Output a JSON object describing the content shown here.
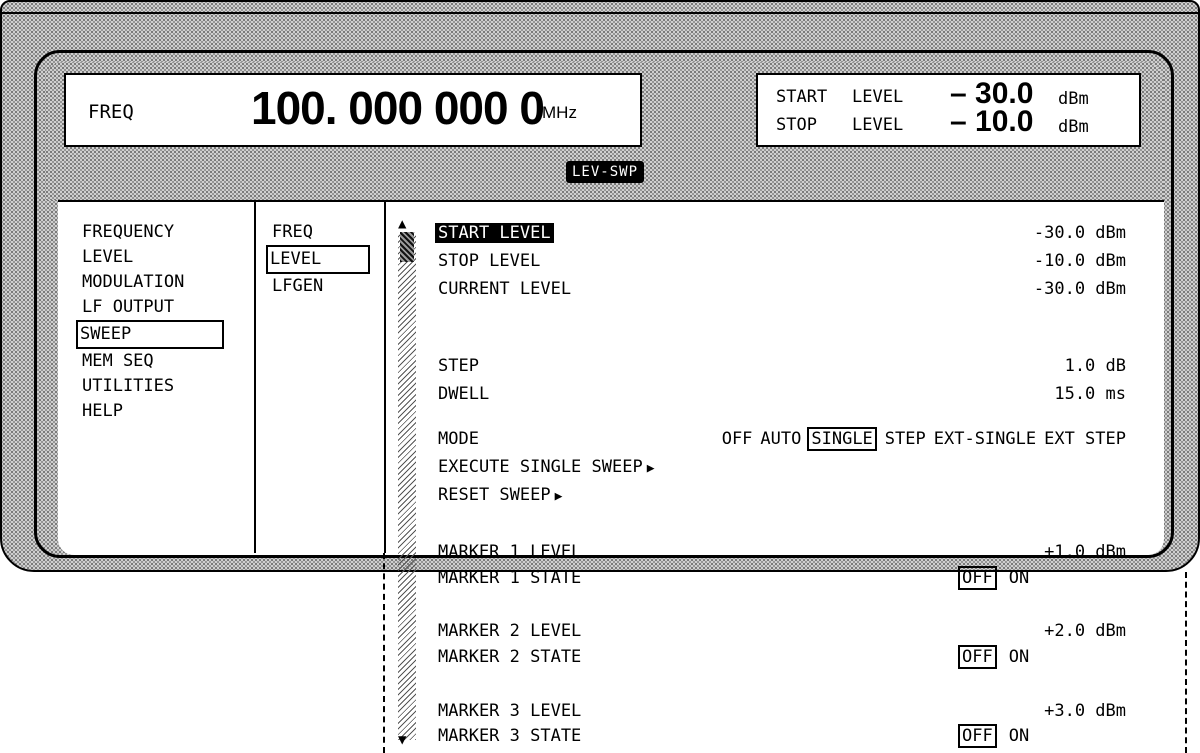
{
  "header": {
    "freq_label": "FREQ",
    "freq_value": "100. 000 000 0",
    "freq_unit": "MHz",
    "start_label_a": "START",
    "start_label_b": "LEVEL",
    "start_value": "– 30.0",
    "start_unit": "dBm",
    "stop_label_a": "STOP",
    "stop_label_b": "LEVEL",
    "stop_value": "– 10.0",
    "stop_unit": "dBm",
    "mode_tag": "LEV-SWP"
  },
  "menu_main": [
    "FREQUENCY",
    "LEVEL",
    "MODULATION",
    "LF OUTPUT",
    "SWEEP",
    "MEM SEQ",
    "UTILITIES",
    "HELP"
  ],
  "menu_sub": [
    "FREQ",
    "LEVEL",
    "LFGEN"
  ],
  "params": {
    "start_level": {
      "label": "START LEVEL",
      "value": "-30.0 dBm"
    },
    "stop_level": {
      "label": "STOP LEVEL",
      "value": "-10.0 dBm"
    },
    "current_level": {
      "label": "CURRENT LEVEL",
      "value": "-30.0 dBm"
    },
    "step": {
      "label": "STEP",
      "value": "1.0 dB"
    },
    "dwell": {
      "label": "DWELL",
      "value": "15.0 ms"
    },
    "mode": {
      "label": "MODE",
      "options": [
        "OFF",
        "AUTO",
        "SINGLE",
        "STEP",
        "EXT-SINGLE",
        "EXT STEP"
      ],
      "selected": "SINGLE"
    },
    "execute": {
      "label": "EXECUTE SINGLE SWEEP"
    },
    "reset": {
      "label": "RESET SWEEP"
    },
    "marker1_level": {
      "label": "MARKER 1 LEVEL",
      "value": "+1.0 dBm"
    },
    "marker1_state": {
      "label": "MARKER 1 STATE",
      "off": "OFF",
      "on": "ON",
      "selected": "OFF"
    },
    "marker2_level": {
      "label": "MARKER 2 LEVEL",
      "value": "+2.0 dBm"
    },
    "marker2_state": {
      "label": "MARKER 2 STATE",
      "off": "OFF",
      "on": "ON",
      "selected": "OFF"
    },
    "marker3_level": {
      "label": "MARKER 3 LEVEL",
      "value": "+3.0 dBm"
    },
    "marker3_state": {
      "label": "MARKER 3 STATE",
      "off": "OFF",
      "on": "ON",
      "selected": "OFF"
    }
  },
  "selected_main": "SWEEP",
  "selected_sub": "LEVEL",
  "icons": {
    "up": "▲",
    "down": "▼",
    "arrow": "▶"
  }
}
